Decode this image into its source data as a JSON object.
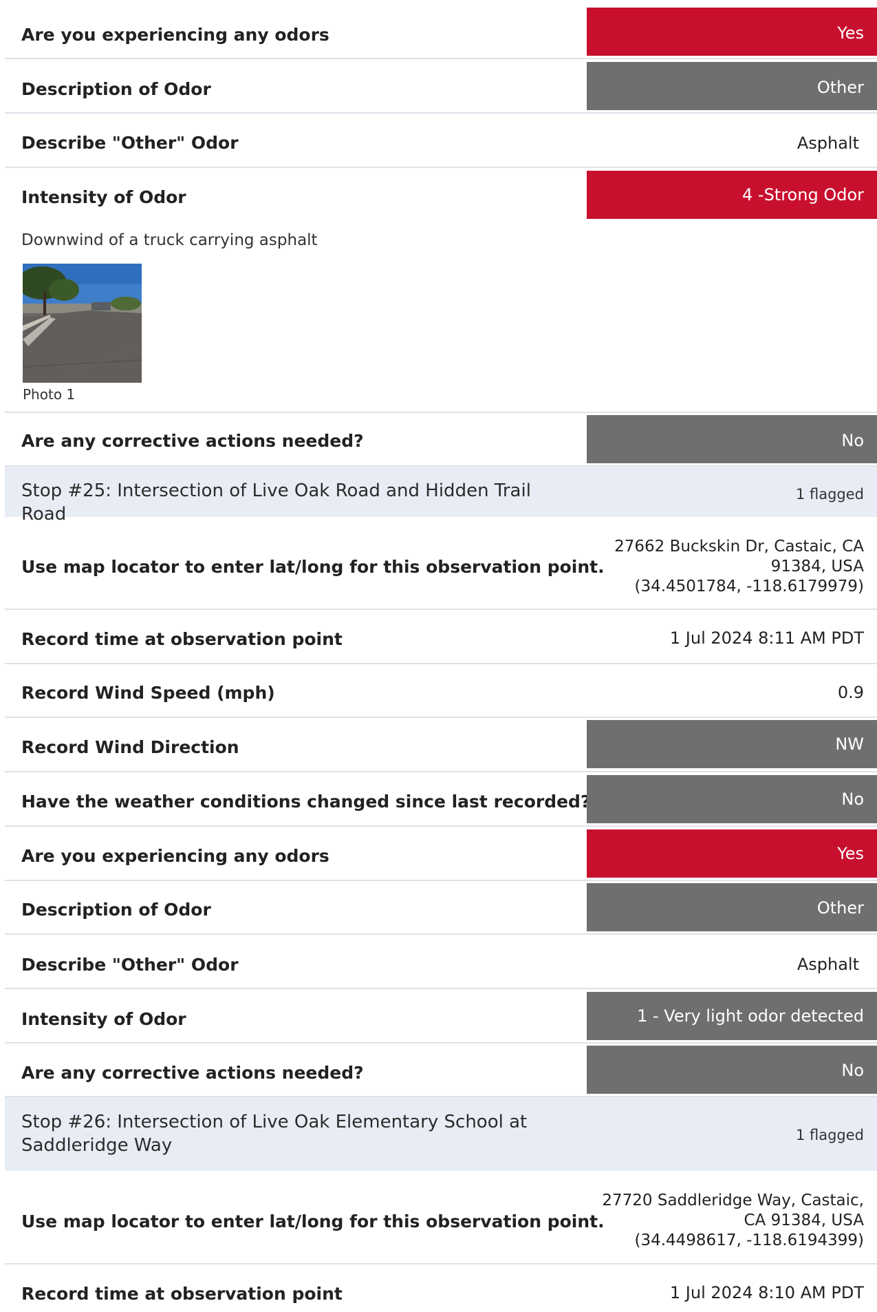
{
  "block1": {
    "odors_q": "Are you experiencing any odors",
    "odors_a": "Yes",
    "desc_q": "Description of Odor",
    "desc_a": "Other",
    "other_q": "Describe \"Other\" Odor",
    "other_a": "Asphalt",
    "intensity_q": "Intensity of Odor",
    "intensity_a": "4 -Strong Odor",
    "note": "Downwind of a truck carrying asphalt",
    "photo_caption": "Photo 1",
    "corrective_q": "Are any corrective actions needed?",
    "corrective_a": "No"
  },
  "stop25": {
    "title": "Stop #25: Intersection of Live Oak Road and Hidden Trail Road",
    "flagged": "1 flagged",
    "map_q": "Use map locator to enter lat/long for this observation point.",
    "map_a_line1": "27662 Buckskin Dr, Castaic, CA",
    "map_a_line2": "91384, USA",
    "map_a_line3": "(34.4501784, -118.6179979)",
    "time_q": "Record time at observation point",
    "time_a": "1 Jul 2024 8:11 AM PDT",
    "wind_speed_q": "Record Wind Speed (mph)",
    "wind_speed_a": "0.9",
    "wind_dir_q": "Record Wind Direction",
    "wind_dir_a": "NW",
    "weather_q": "Have the weather conditions changed since last recorded?",
    "weather_a": "No",
    "odors_q": "Are you experiencing any odors",
    "odors_a": "Yes",
    "desc_q": "Description of Odor",
    "desc_a": "Other",
    "other_q": "Describe \"Other\" Odor",
    "other_a": "Asphalt",
    "intensity_q": "Intensity of Odor",
    "intensity_a": "1 - Very light odor detected",
    "corrective_q": "Are any corrective actions needed?",
    "corrective_a": "No"
  },
  "stop26": {
    "title_line1": "Stop #26: Intersection of Live Oak Elementary School at",
    "title_line2": "Saddleridge Way",
    "flagged": "1 flagged",
    "map_q": "Use map locator to enter lat/long for this observation point.",
    "map_a_line1": "27720 Saddleridge Way, Castaic,",
    "map_a_line2": "CA 91384, USA",
    "map_a_line3": "(34.4498617, -118.6194399)",
    "time_q": "Record time at observation point",
    "time_a": "1 Jul 2024 8:10 AM PDT"
  },
  "colors": {
    "flag_red": "#c8102e",
    "neutral_grey": "#6f6f6f",
    "section_bg": "#e8edf5",
    "divider": "#dfe2ea"
  }
}
